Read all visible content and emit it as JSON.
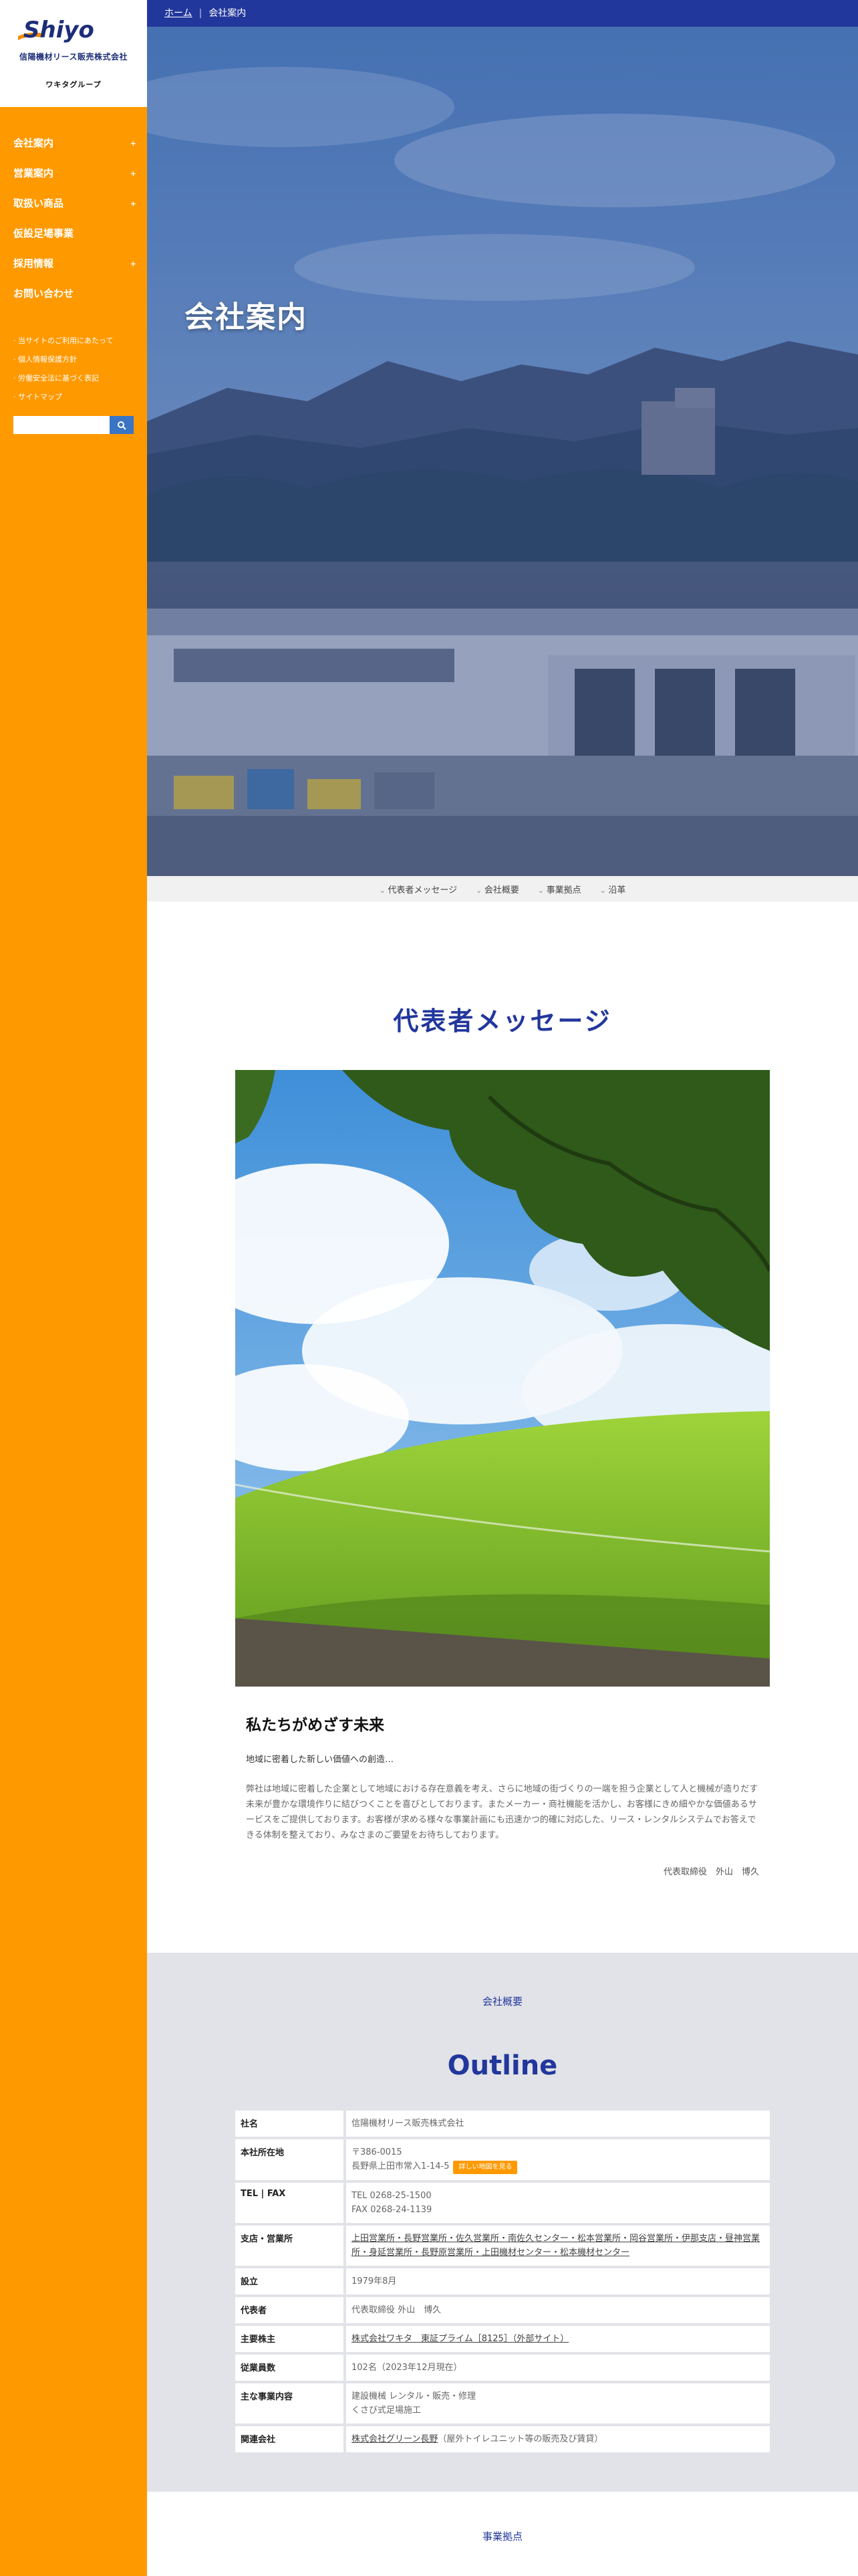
{
  "colors": {
    "accent": "#ff9900",
    "brand_blue": "#22379c",
    "outline_bg": "#e2e3e8"
  },
  "brand": {
    "logo_text": "Shiyo",
    "company_sub": "信陽機材リース販売株式会社",
    "group": "ワキタグループ"
  },
  "nav": {
    "items": [
      {
        "label": "会社案内",
        "has_children": true
      },
      {
        "label": "営業案内",
        "has_children": true
      },
      {
        "label": "取扱い商品",
        "has_children": true
      },
      {
        "label": "仮設足場事業",
        "has_children": false
      },
      {
        "label": "採用情報",
        "has_children": true
      },
      {
        "label": "お問い合わせ",
        "has_children": false
      }
    ],
    "chevron": "+",
    "sublinks": [
      "当サイトのご利用にあたって",
      "個人情報保護方針",
      "労働安全法に基づく表記",
      "サイトマップ"
    ]
  },
  "search": {
    "placeholder": "",
    "icon": "search-icon"
  },
  "breadcrumb": {
    "home": "ホーム",
    "current": "会社案内"
  },
  "hero": {
    "title": "会社案内"
  },
  "anchor_nav": [
    "代表者メッセージ",
    "会社概要",
    "事業拠点",
    "沿革"
  ],
  "message": {
    "section_title": "代表者メッセージ",
    "heading": "私たちがめざす未来",
    "lead": "地域に密着した新しい価値への創造…",
    "body": "弊社は地域に密着した企業として地域における存在意義を考え、さらに地域の街づくりの一端を担う企業として人と機械が造りだす未来が豊かな環境作りに結びつくことを喜びとしております。またメーカー・商社機能を活かし、お客様にきめ細やかな価値あるサービスをご提供しております。お客様が求める様々な事業計画にも迅速かつ的確に対応した、リース・レンタルシステムでお答えできる体制を整えており、みなさまのご要望をお待ちしております。",
    "signature": "代表取締役　外山　博久"
  },
  "outline": {
    "subtitle": "会社概要",
    "title": "Outline",
    "rows": [
      {
        "label": "社名",
        "lines": [
          "信陽機材リース販売株式会社"
        ]
      },
      {
        "label": "本社所在地",
        "lines": [
          "〒386-0015",
          "長野県上田市常入1-14-5"
        ],
        "map_button": "詳しい地図を見る"
      },
      {
        "label": "TEL | FAX",
        "lines": [
          "TEL 0268-25-1500",
          "FAX 0268-24-1139"
        ]
      },
      {
        "label": "支店・営業所",
        "links": "上田営業所・長野営業所・佐久営業所・南佐久センター・松本営業所・岡谷営業所・伊那支店・昼神営業所・身延営業所・長野原営業所・上田機材センター・松本機材センター"
      },
      {
        "label": "設立",
        "lines": [
          "1979年8月"
        ]
      },
      {
        "label": "代表者",
        "lines": [
          "代表取締役 外山　博久"
        ]
      },
      {
        "label": "主要株主",
        "links": "株式会社ワキタ　東証プライム［8125］（外部サイト）"
      },
      {
        "label": "従業員数",
        "lines": [
          "102名（2023年12月現在）"
        ]
      },
      {
        "label": "主な事業内容",
        "lines": [
          "建設機械 レンタル・販売・修理",
          "くさび式足場施工"
        ]
      },
      {
        "label": "関連会社",
        "links": "株式会社グリーン長野",
        "extra": "（屋外トイレユニット等の販売及び賃貸）"
      }
    ]
  },
  "next_section": {
    "subtitle": "事業拠点"
  }
}
